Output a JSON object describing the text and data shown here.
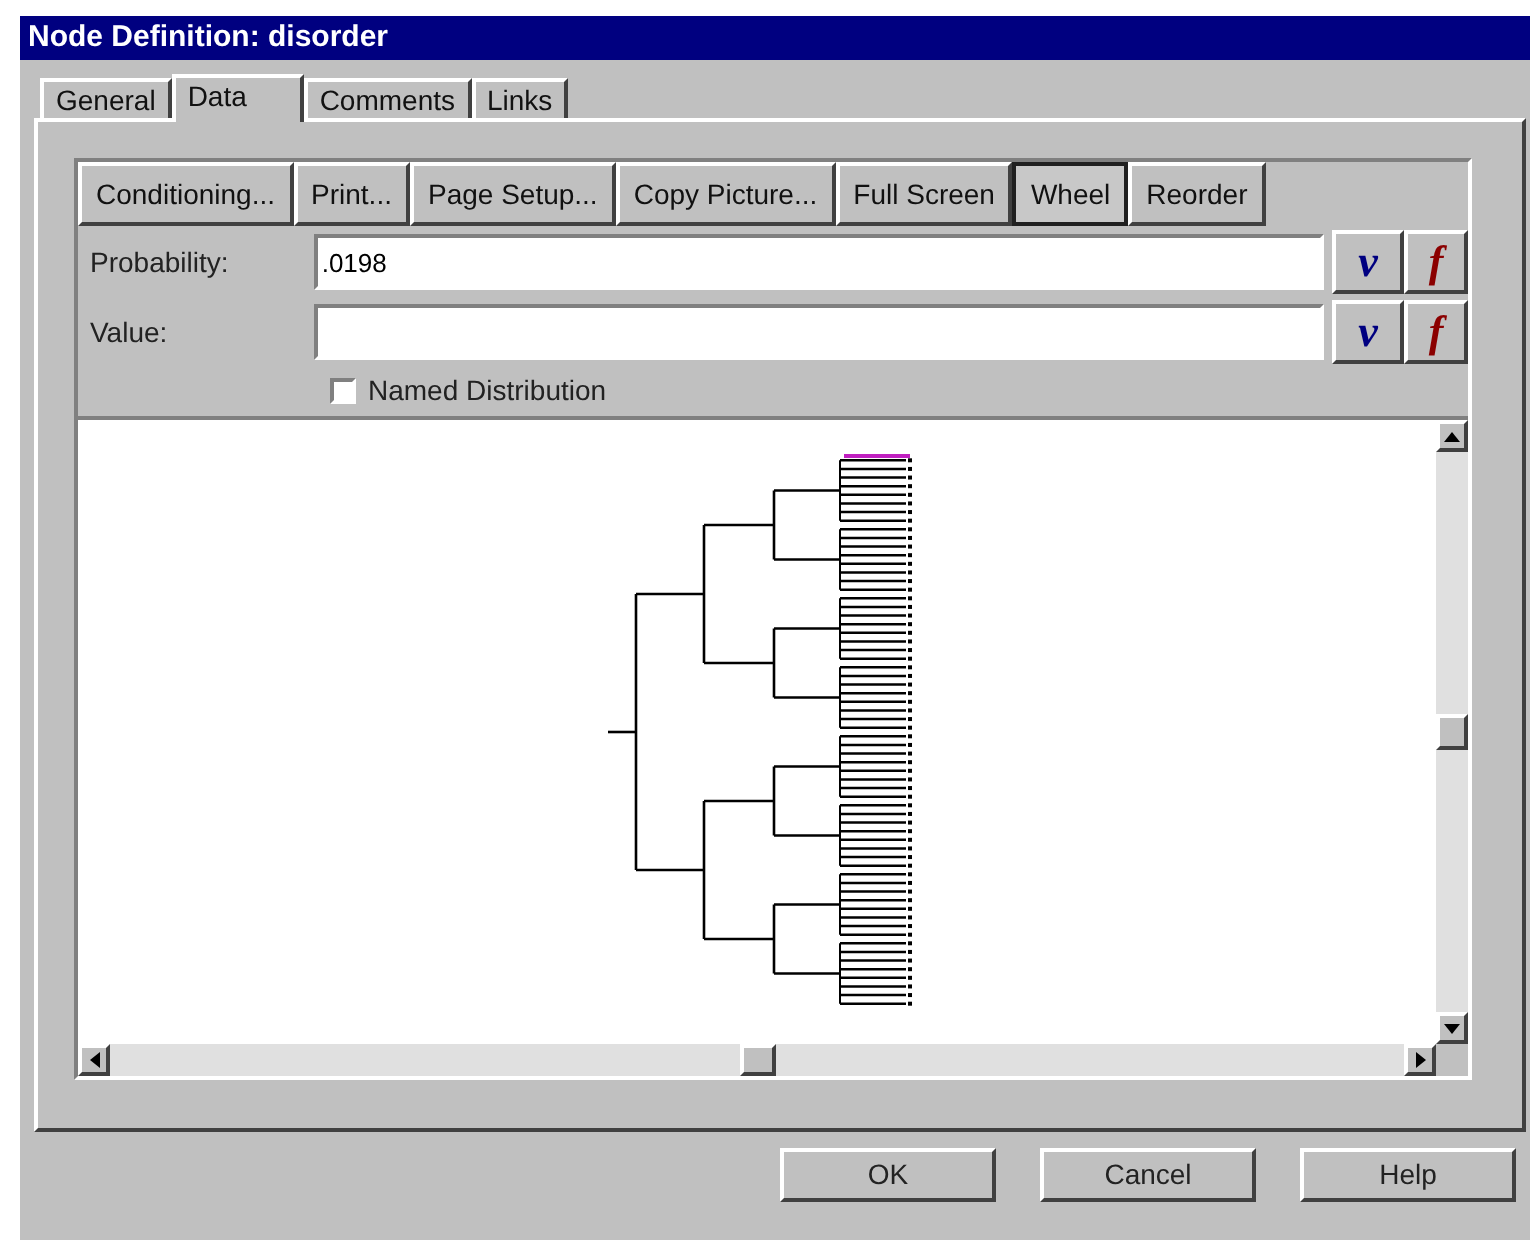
{
  "window": {
    "title": "Node Definition: disorder"
  },
  "tabs": [
    {
      "label": "General",
      "selected": false
    },
    {
      "label": "Data",
      "selected": true
    },
    {
      "label": "Comments",
      "selected": false
    },
    {
      "label": "Links",
      "selected": false
    }
  ],
  "toolbar": [
    {
      "label": "Conditioning...",
      "selected": false
    },
    {
      "label": "Print...",
      "selected": false
    },
    {
      "label": "Page Setup...",
      "selected": false
    },
    {
      "label": "Copy Picture...",
      "selected": false
    },
    {
      "label": "Full Screen",
      "selected": false
    },
    {
      "label": "Wheel",
      "selected": true
    },
    {
      "label": "Reorder",
      "selected": false
    }
  ],
  "fields": [
    {
      "label": "Probability:",
      "value": ".0198",
      "v_button": "v",
      "f_button": "f"
    },
    {
      "label": "Value:",
      "v_button": "v",
      "f_button": "f"
    }
  ],
  "named_distribution": {
    "label": "Named Distribution",
    "checked": false
  },
  "buttons": [
    "OK",
    "Cancel",
    "Help"
  ]
}
